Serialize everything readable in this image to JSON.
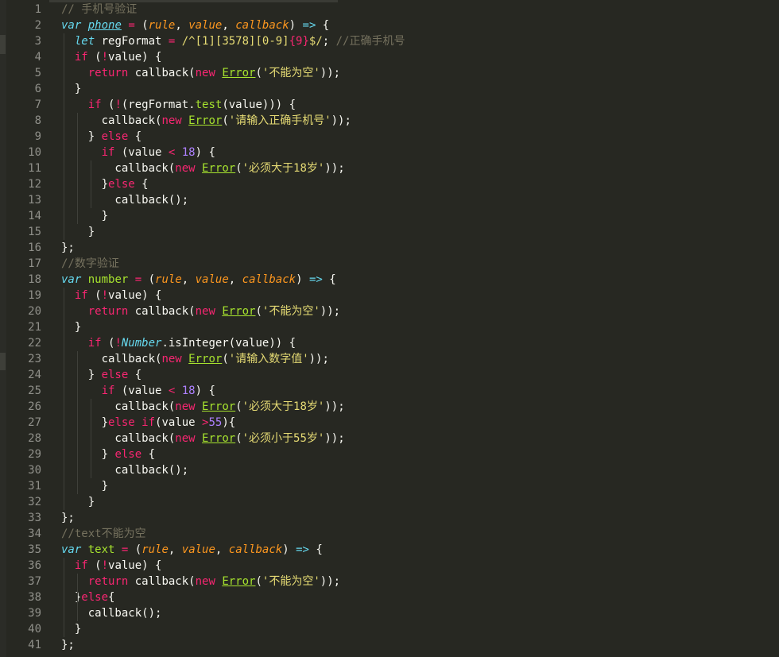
{
  "editor": {
    "theme_colors": {
      "background": "#272822",
      "keyword": "#f92672",
      "storage": "#66d9ef",
      "function": "#a6e22e",
      "parameter": "#fd971f",
      "number": "#ae81ff",
      "string": "#e6db74",
      "comment": "#75715e",
      "foreground": "#f8f8f2",
      "line_number": "#90908a"
    },
    "line_numbers": [
      "1",
      "2",
      "3",
      "4",
      "5",
      "6",
      "7",
      "8",
      "9",
      "10",
      "11",
      "12",
      "13",
      "14",
      "15",
      "16",
      "17",
      "18",
      "19",
      "20",
      "21",
      "22",
      "23",
      "24",
      "25",
      "26",
      "27",
      "28",
      "29",
      "30",
      "31",
      "32",
      "33",
      "34",
      "35",
      "36",
      "37",
      "38",
      "39",
      "40",
      "41"
    ],
    "lines": [
      [
        {
          "t": "// 手机号验证",
          "c": "cm"
        }
      ],
      [
        {
          "t": "var",
          "c": "st"
        },
        {
          "t": " "
        },
        {
          "t": "phone",
          "c": "nb",
          "u": true
        },
        {
          "t": " "
        },
        {
          "t": "=",
          "c": "kw"
        },
        {
          "t": " ("
        },
        {
          "t": "rule",
          "c": "pa"
        },
        {
          "t": ", "
        },
        {
          "t": "value",
          "c": "pa"
        },
        {
          "t": ", "
        },
        {
          "t": "callback",
          "c": "pa"
        },
        {
          "t": ") "
        },
        {
          "t": "=>",
          "c": "st"
        },
        {
          "t": " {"
        }
      ],
      [
        {
          "t": "  "
        },
        {
          "t": "let",
          "c": "st"
        },
        {
          "t": " regFormat "
        },
        {
          "t": "=",
          "c": "kw"
        },
        {
          "t": " "
        },
        {
          "t": "/^[1][3578][0-9]",
          "c": "s"
        },
        {
          "t": "{9}",
          "c": "kw"
        },
        {
          "t": "$/",
          "c": "s"
        },
        {
          "t": "; "
        },
        {
          "t": "//正确手机号",
          "c": "cm"
        }
      ],
      [
        {
          "t": "  "
        },
        {
          "t": "if",
          "c": "kw"
        },
        {
          "t": " ("
        },
        {
          "t": "!",
          "c": "kw"
        },
        {
          "t": "value) {"
        }
      ],
      [
        {
          "t": "    "
        },
        {
          "t": "return",
          "c": "kw"
        },
        {
          "t": " callback("
        },
        {
          "t": "new",
          "c": "kw"
        },
        {
          "t": " "
        },
        {
          "t": "Error",
          "c": "fnu"
        },
        {
          "t": "("
        },
        {
          "t": "'不能为空'",
          "c": "s"
        },
        {
          "t": "));"
        }
      ],
      [
        {
          "t": "  }"
        }
      ],
      [
        {
          "t": "    "
        },
        {
          "t": "if",
          "c": "kw"
        },
        {
          "t": " ("
        },
        {
          "t": "!",
          "c": "kw"
        },
        {
          "t": "(regFormat."
        },
        {
          "t": "test",
          "c": "fn"
        },
        {
          "t": "(value))) {"
        }
      ],
      [
        {
          "t": "      callback("
        },
        {
          "t": "new",
          "c": "kw"
        },
        {
          "t": " "
        },
        {
          "t": "Error",
          "c": "fnu"
        },
        {
          "t": "("
        },
        {
          "t": "'请输入正确手机号'",
          "c": "s"
        },
        {
          "t": "));"
        }
      ],
      [
        {
          "t": "    } "
        },
        {
          "t": "else",
          "c": "kw"
        },
        {
          "t": " {"
        }
      ],
      [
        {
          "t": "      "
        },
        {
          "t": "if",
          "c": "kw"
        },
        {
          "t": " (value "
        },
        {
          "t": "<",
          "c": "kw"
        },
        {
          "t": " "
        },
        {
          "t": "18",
          "c": "nu"
        },
        {
          "t": ") {"
        }
      ],
      [
        {
          "t": "        callback("
        },
        {
          "t": "new",
          "c": "kw"
        },
        {
          "t": " "
        },
        {
          "t": "Error",
          "c": "fnu"
        },
        {
          "t": "("
        },
        {
          "t": "'必须大于18岁'",
          "c": "s"
        },
        {
          "t": "));"
        }
      ],
      [
        {
          "t": "      }"
        },
        {
          "t": "else",
          "c": "kw"
        },
        {
          "t": " {"
        }
      ],
      [
        {
          "t": "        callback();"
        }
      ],
      [
        {
          "t": "      }"
        }
      ],
      [
        {
          "t": "    }"
        }
      ],
      [
        {
          "t": "};"
        }
      ],
      [
        {
          "t": "//数字验证",
          "c": "cm"
        }
      ],
      [
        {
          "t": "var",
          "c": "st"
        },
        {
          "t": " "
        },
        {
          "t": "number",
          "c": "fn"
        },
        {
          "t": " "
        },
        {
          "t": "=",
          "c": "kw"
        },
        {
          "t": " ("
        },
        {
          "t": "rule",
          "c": "pa"
        },
        {
          "t": ", "
        },
        {
          "t": "value",
          "c": "pa"
        },
        {
          "t": ", "
        },
        {
          "t": "callback",
          "c": "pa"
        },
        {
          "t": ") "
        },
        {
          "t": "=>",
          "c": "st"
        },
        {
          "t": " {"
        }
      ],
      [
        {
          "t": "  "
        },
        {
          "t": "if",
          "c": "kw"
        },
        {
          "t": " ("
        },
        {
          "t": "!",
          "c": "kw"
        },
        {
          "t": "value) {"
        }
      ],
      [
        {
          "t": "    "
        },
        {
          "t": "return",
          "c": "kw"
        },
        {
          "t": " callback("
        },
        {
          "t": "new",
          "c": "kw"
        },
        {
          "t": " "
        },
        {
          "t": "Error",
          "c": "fnu"
        },
        {
          "t": "("
        },
        {
          "t": "'不能为空'",
          "c": "s"
        },
        {
          "t": "));"
        }
      ],
      [
        {
          "t": "  }"
        }
      ],
      [
        {
          "t": "    "
        },
        {
          "t": "if",
          "c": "kw"
        },
        {
          "t": " ("
        },
        {
          "t": "!",
          "c": "kw"
        },
        {
          "t": "Number",
          "c": "nb"
        },
        {
          "t": ".isInteger(value)) {"
        }
      ],
      [
        {
          "t": "      callback("
        },
        {
          "t": "new",
          "c": "kw"
        },
        {
          "t": " "
        },
        {
          "t": "Error",
          "c": "fnu"
        },
        {
          "t": "("
        },
        {
          "t": "'请输入数字值'",
          "c": "s"
        },
        {
          "t": "));"
        }
      ],
      [
        {
          "t": "    } "
        },
        {
          "t": "else",
          "c": "kw"
        },
        {
          "t": " {"
        }
      ],
      [
        {
          "t": "      "
        },
        {
          "t": "if",
          "c": "kw"
        },
        {
          "t": " (value "
        },
        {
          "t": "<",
          "c": "kw"
        },
        {
          "t": " "
        },
        {
          "t": "18",
          "c": "nu"
        },
        {
          "t": ") {"
        }
      ],
      [
        {
          "t": "        callback("
        },
        {
          "t": "new",
          "c": "kw"
        },
        {
          "t": " "
        },
        {
          "t": "Error",
          "c": "fnu"
        },
        {
          "t": "("
        },
        {
          "t": "'必须大于18岁'",
          "c": "s"
        },
        {
          "t": "));"
        }
      ],
      [
        {
          "t": "      }"
        },
        {
          "t": "else",
          "c": "kw"
        },
        {
          "t": " "
        },
        {
          "t": "if",
          "c": "kw"
        },
        {
          "t": "(value "
        },
        {
          "t": ">",
          "c": "kw"
        },
        {
          "t": "55",
          "c": "nu"
        },
        {
          "t": "){"
        }
      ],
      [
        {
          "t": "        callback("
        },
        {
          "t": "new",
          "c": "kw"
        },
        {
          "t": " "
        },
        {
          "t": "Error",
          "c": "fnu"
        },
        {
          "t": "("
        },
        {
          "t": "'必须小于55岁'",
          "c": "s"
        },
        {
          "t": "));"
        }
      ],
      [
        {
          "t": "      } "
        },
        {
          "t": "else",
          "c": "kw"
        },
        {
          "t": " {"
        }
      ],
      [
        {
          "t": "        callback();"
        }
      ],
      [
        {
          "t": "      }"
        }
      ],
      [
        {
          "t": "    }"
        }
      ],
      [
        {
          "t": "};"
        }
      ],
      [
        {
          "t": "//text不能为空",
          "c": "cm"
        }
      ],
      [
        {
          "t": "var",
          "c": "st"
        },
        {
          "t": " "
        },
        {
          "t": "text",
          "c": "fn"
        },
        {
          "t": " "
        },
        {
          "t": "=",
          "c": "kw"
        },
        {
          "t": " ("
        },
        {
          "t": "rule",
          "c": "pa"
        },
        {
          "t": ", "
        },
        {
          "t": "value",
          "c": "pa"
        },
        {
          "t": ", "
        },
        {
          "t": "callback",
          "c": "pa"
        },
        {
          "t": ") "
        },
        {
          "t": "=>",
          "c": "st"
        },
        {
          "t": " {"
        }
      ],
      [
        {
          "t": "  "
        },
        {
          "t": "if",
          "c": "kw"
        },
        {
          "t": " ("
        },
        {
          "t": "!",
          "c": "kw"
        },
        {
          "t": "value) {"
        }
      ],
      [
        {
          "t": "    "
        },
        {
          "t": "return",
          "c": "kw"
        },
        {
          "t": " callback("
        },
        {
          "t": "new",
          "c": "kw"
        },
        {
          "t": " "
        },
        {
          "t": "Error",
          "c": "fnu"
        },
        {
          "t": "("
        },
        {
          "t": "'不能为空'",
          "c": "s"
        },
        {
          "t": "));"
        }
      ],
      [
        {
          "t": "  }"
        },
        {
          "t": "else",
          "c": "kw"
        },
        {
          "t": "{"
        }
      ],
      [
        {
          "t": "    callback();"
        }
      ],
      [
        {
          "t": "  }"
        }
      ],
      [
        {
          "t": "};"
        }
      ]
    ]
  }
}
